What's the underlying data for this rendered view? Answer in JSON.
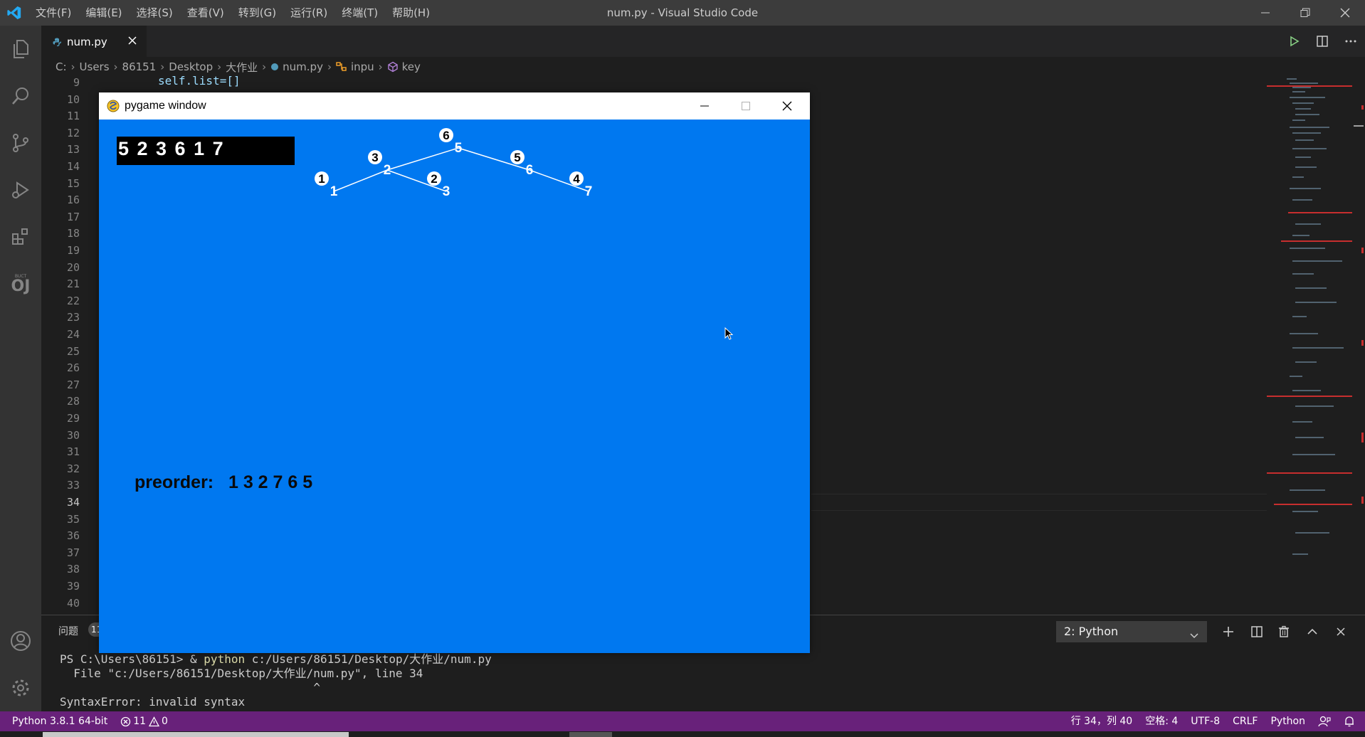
{
  "window": {
    "title": "num.py - Visual Studio Code",
    "menu": [
      "文件(F)",
      "编辑(E)",
      "选择(S)",
      "查看(V)",
      "转到(G)",
      "运行(R)",
      "终端(T)",
      "帮助(H)"
    ]
  },
  "activity_bar": [
    "explorer-icon",
    "search-icon",
    "source-control-icon",
    "run-debug-icon",
    "extensions-icon",
    "oj-icon",
    "account-icon",
    "settings-gear-icon"
  ],
  "activity_oj": {
    "small": "BUCT",
    "big": "OJ"
  },
  "tab": {
    "filename": "num.py"
  },
  "breadcrumb": [
    "C:",
    "Users",
    "86151",
    "Desktop",
    "大作业",
    "num.py",
    "inpu",
    "key"
  ],
  "editor": {
    "visible_code": "self.list=[]",
    "line_numbers": [
      "9",
      "10",
      "11",
      "12",
      "13",
      "14",
      "15",
      "16",
      "17",
      "18",
      "19",
      "20",
      "21",
      "22",
      "23",
      "24",
      "25",
      "26",
      "27",
      "28",
      "29",
      "30",
      "31",
      "32",
      "33",
      "34",
      "35",
      "36",
      "37",
      "38",
      "39",
      "40"
    ],
    "active_line": "34"
  },
  "panel": {
    "tab_label": "问题",
    "badge": "11",
    "terminal_select": "2: Python",
    "terminal_lines": {
      "prompt": "PS C:\\Users\\86151> & ",
      "command": "python",
      "args": " c:/Users/86151/Desktop/大作业/num.py",
      "error_file": "  File \"c:/Users/86151/Desktop/大作业/num.py\", line 34",
      "caret": "                                     ^",
      "error": "SyntaxError: invalid syntax"
    }
  },
  "statusbar": {
    "interpreter": "Python 3.8.1 64-bit",
    "errors": "11",
    "warnings": "0",
    "position": "行 34，列 40",
    "spaces": "空格: 4",
    "encoding": "UTF-8",
    "eol": "CRLF",
    "language": "Python"
  },
  "pygame": {
    "title": "pygame window",
    "input_text": "5 2 3 6 1 7",
    "preorder_label": "preorder:",
    "preorder_value": "1 3 2 7 6 5",
    "tree": {
      "nodes": [
        {
          "value": "5",
          "badge": "6"
        },
        {
          "value": "2",
          "badge": "3"
        },
        {
          "value": "6",
          "badge": "5"
        },
        {
          "value": "1",
          "badge": "1"
        },
        {
          "value": "3",
          "badge": "2"
        },
        {
          "value": "7",
          "badge": "4"
        }
      ],
      "edges": [
        [
          "5",
          "2"
        ],
        [
          "5",
          "6"
        ],
        [
          "2",
          "1"
        ],
        [
          "2",
          "3"
        ],
        [
          "6",
          "7"
        ]
      ]
    }
  },
  "colors": {
    "statusbar": "#68217a",
    "pygame_bg": "#0078f0",
    "editor_bg": "#1e1e1e"
  }
}
